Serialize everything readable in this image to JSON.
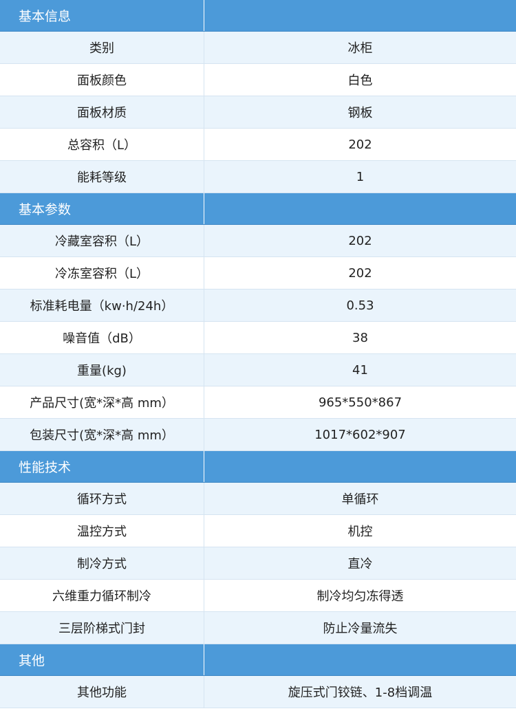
{
  "colors": {
    "section_bg": "#4c9ad9",
    "row_alt_bg": "#eaf4fc",
    "row_bg": "#ffffff",
    "text": "#222222"
  },
  "sections": [
    {
      "title": "基本信息",
      "rows": [
        {
          "label": "类别",
          "value": "冰柜"
        },
        {
          "label": "面板颜色",
          "value": "白色"
        },
        {
          "label": "面板材质",
          "value": "钢板"
        },
        {
          "label": "总容积（L）",
          "value": "202"
        },
        {
          "label": "能耗等级",
          "value": "1"
        }
      ]
    },
    {
      "title": "基本参数",
      "rows": [
        {
          "label": "冷藏室容积（L）",
          "value": "202"
        },
        {
          "label": "冷冻室容积（L）",
          "value": "202"
        },
        {
          "label": "标准耗电量（kw·h/24h）",
          "value": "0.53"
        },
        {
          "label": "噪音值（dB）",
          "value": "38"
        },
        {
          "label": "重量(kg)",
          "value": "41"
        },
        {
          "label": "产品尺寸(宽*深*高 mm）",
          "value": "965*550*867"
        },
        {
          "label": "包装尺寸(宽*深*高 mm）",
          "value": "1017*602*907"
        }
      ]
    },
    {
      "title": "性能技术",
      "rows": [
        {
          "label": "循环方式",
          "value": "单循环"
        },
        {
          "label": "温控方式",
          "value": "机控"
        },
        {
          "label": "制冷方式",
          "value": "直冷"
        },
        {
          "label": "六维重力循环制冷",
          "value": "制冷均匀冻得透"
        },
        {
          "label": "三层阶梯式门封",
          "value": "防止冷量流失"
        }
      ]
    },
    {
      "title": "其他",
      "rows": [
        {
          "label": "其他功能",
          "value": "旋压式门铰链、1-8档调温"
        }
      ]
    }
  ]
}
